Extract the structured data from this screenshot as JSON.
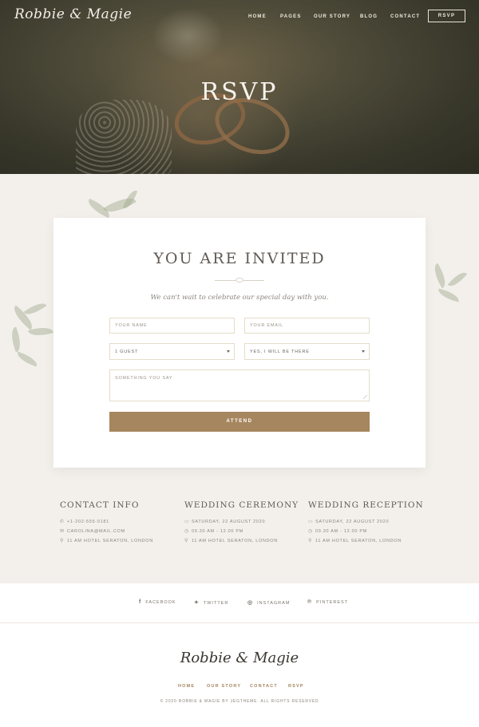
{
  "header": {
    "logo": "Robbie & Magie",
    "nav": [
      {
        "label": "HOME"
      },
      {
        "label": "PAGES"
      },
      {
        "label": "OUR STORY"
      },
      {
        "label": "BLOG"
      },
      {
        "label": "CONTACT"
      }
    ],
    "cta_label": "RSVP"
  },
  "hero": {
    "title": "RSVP"
  },
  "form": {
    "title": "YOU ARE INVITED",
    "tagline": "We can't wait to celebrate our special day with you.",
    "name_placeholder": "YOUR NAME",
    "email_placeholder": "YOUR EMAIL",
    "guests_value": "1 GUEST",
    "attendance_value": "YES, I WILL BE THERE",
    "message_placeholder": "SOMETHING YOU SAY",
    "submit_label": "ATTEND"
  },
  "info": [
    {
      "title": "CONTACT INFO",
      "rows": [
        {
          "icon": "phone-icon",
          "glyph": "✆",
          "text": "+1-202-555-0181"
        },
        {
          "icon": "mail-icon",
          "glyph": "✉",
          "text": "CAROLINA@MAIL.COM"
        },
        {
          "icon": "location-icon",
          "glyph": "⚲",
          "text": "11 AM HOTEL SERATON, LONDON"
        }
      ]
    },
    {
      "title": "WEDDING CEREMONY",
      "rows": [
        {
          "icon": "calendar-icon",
          "glyph": "▭",
          "text": "SATURDAY, 22 AUGUST 2020"
        },
        {
          "icon": "clock-icon",
          "glyph": "◷",
          "text": "09.30 AM - 12.00 PM"
        },
        {
          "icon": "location-icon",
          "glyph": "⚲",
          "text": "11 AM HOTEL SERATON, LONDON"
        }
      ]
    },
    {
      "title": "WEDDING RECEPTION",
      "rows": [
        {
          "icon": "calendar-icon",
          "glyph": "▭",
          "text": "SATURDAY, 22 AUGUST 2020"
        },
        {
          "icon": "clock-icon",
          "glyph": "◷",
          "text": "09.30 AM - 12.00 PM"
        },
        {
          "icon": "location-icon",
          "glyph": "⚲",
          "text": "11 AM HOTEL SERATON, LONDON"
        }
      ]
    }
  ],
  "social": [
    {
      "icon": "facebook-icon",
      "glyph": "f",
      "label": "FACEBOOK"
    },
    {
      "icon": "twitter-icon",
      "glyph": "✦",
      "label": "TWITTER"
    },
    {
      "icon": "instagram-icon",
      "glyph": "◎",
      "label": "INSTAGRAM"
    },
    {
      "icon": "pinterest-icon",
      "glyph": "℗",
      "label": "PINTEREST"
    }
  ],
  "footer": {
    "logo": "Robbie & Magie",
    "nav": [
      {
        "label": "HOME"
      },
      {
        "label": "OUR STORY"
      },
      {
        "label": "CONTACT"
      },
      {
        "label": "RSVP"
      }
    ],
    "copyright": "© 2020 ROBBIE & MAGIE BY JEGTHEME. ALL RIGHTS RESERVED"
  },
  "colors": {
    "accent": "#a6865e",
    "page_bg": "#f3f0ec",
    "text": "#6d6862"
  }
}
